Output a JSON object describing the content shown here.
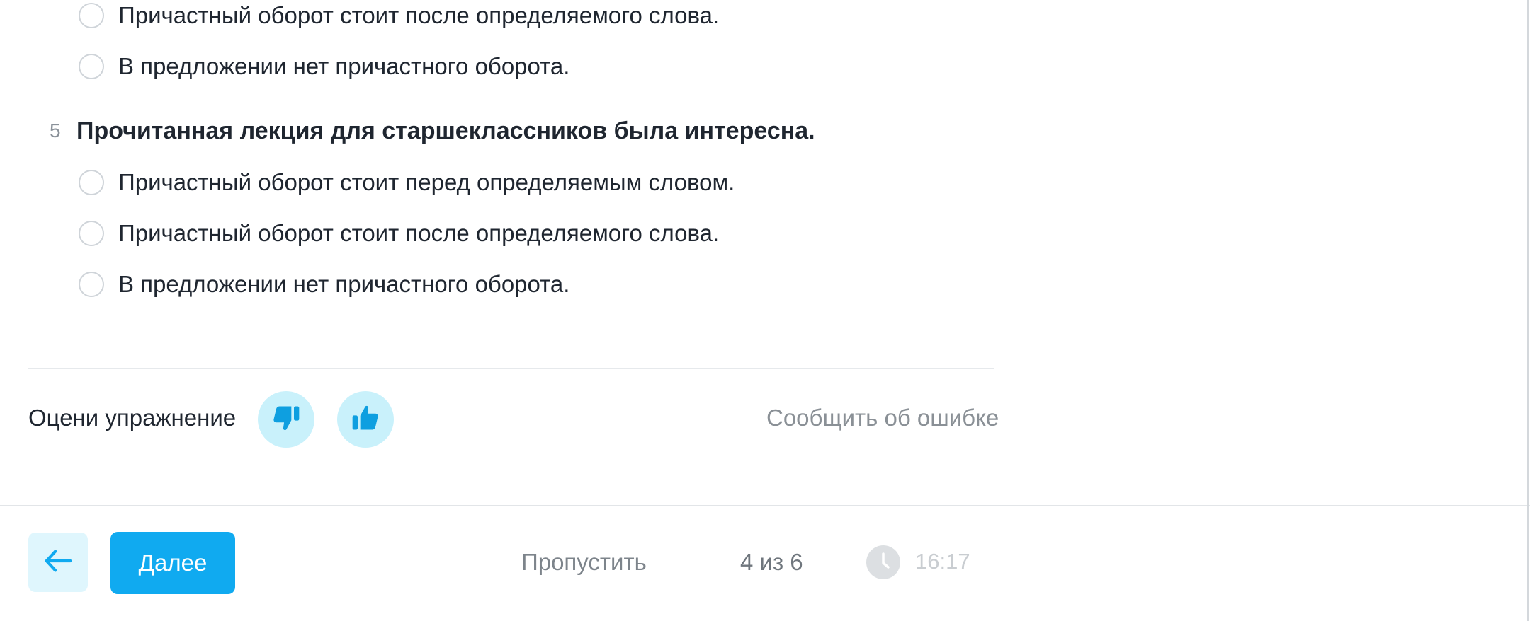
{
  "questions": [
    {
      "options": [
        "Причастный оборот стоит после определяемого слова.",
        "В предложении нет причастного оборота."
      ]
    },
    {
      "number": "5",
      "text": "Прочитанная лекция для старшеклассников была интересна.",
      "options": [
        "Причастный оборот стоит перед определяемым словом.",
        "Причастный оборот стоит после определяемого слова.",
        "В предложении нет причастного оборота."
      ]
    }
  ],
  "rating": {
    "label": "Оцени упражнение",
    "dislike_icon": "thumbs-down-icon",
    "like_icon": "thumbs-up-icon",
    "accent_color": "#c9f1fb",
    "icon_color": "#0e9fe0"
  },
  "report_label": "Сообщить об ошибке",
  "footer": {
    "back_icon": "arrow-left-icon",
    "next_label": "Далее",
    "next_color": "#10aaf0",
    "skip_label": "Пропустить",
    "progress": "4 из 6",
    "clock_icon": "clock-icon",
    "timer": "16:17"
  }
}
